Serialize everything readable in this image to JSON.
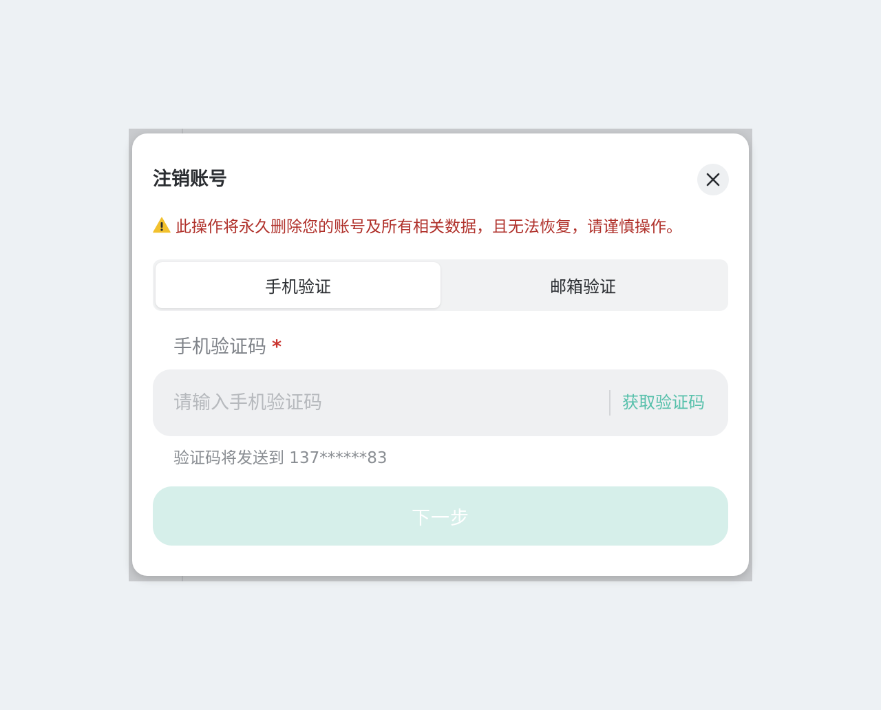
{
  "dialog": {
    "title": "注销账号",
    "close_icon": "close-icon",
    "warning": {
      "icon": "warning-icon",
      "text": "此操作将永久删除您的账号及所有相关数据，且无法恢复，请谨慎操作。"
    },
    "tabs": [
      {
        "label": "手机验证",
        "active": true
      },
      {
        "label": "邮箱验证",
        "active": false
      }
    ],
    "field": {
      "label": "手机验证码",
      "required_mark": "*",
      "placeholder": "请输入手机验证码",
      "value": "",
      "get_code_label": "获取验证码"
    },
    "hint": "验证码将发送到 137******83",
    "next_label": "下一步"
  },
  "colors": {
    "page_bg": "#edf1f4",
    "warning_text": "#b0312b",
    "warning_icon": "#f2c12e",
    "accent": "#57c0ab",
    "button_disabled_bg": "#d6efea"
  }
}
